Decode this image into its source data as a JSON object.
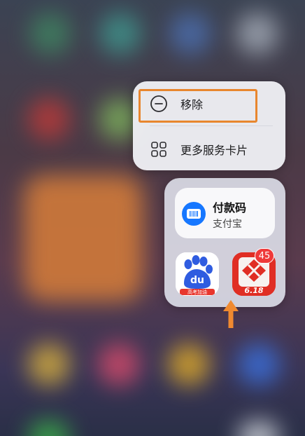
{
  "context_menu": {
    "items": [
      {
        "label": "移除",
        "icon": "remove-circle-icon"
      },
      {
        "label": "更多服务卡片",
        "icon": "grid-four-squares-icon"
      }
    ]
  },
  "widget": {
    "payment_card": {
      "title": "付款码",
      "subtitle": "支付宝",
      "icon": "barcode-icon",
      "accent": "#1677ff"
    },
    "apps": [
      {
        "name": "Baidu",
        "icon": "baidu-paw-icon",
        "text": "du",
        "banner": "高考加油"
      },
      {
        "name": "Pinduoduo",
        "icon": "pinduoduo-icon",
        "text": "6.18",
        "badge": "45"
      }
    ]
  },
  "annotation": {
    "highlight_color": "#e8862e",
    "arrow_color": "#f08a30"
  }
}
